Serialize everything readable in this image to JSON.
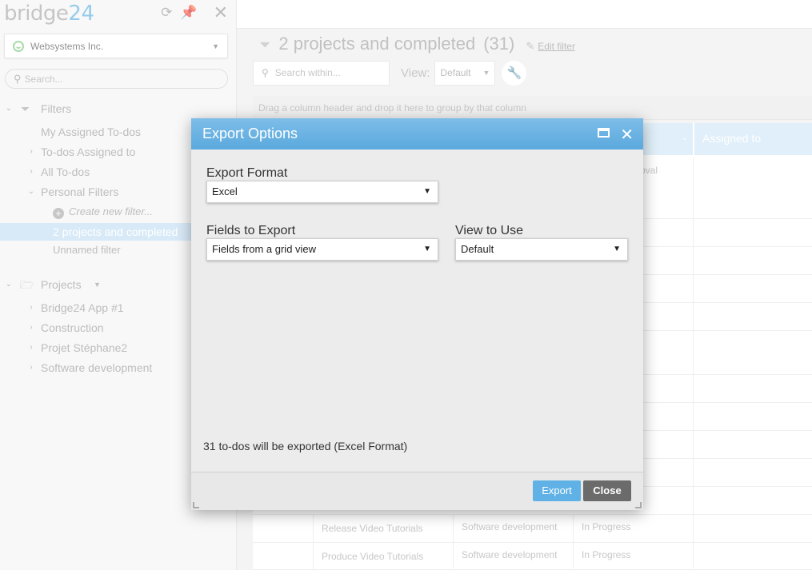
{
  "app": {
    "logo_text": "bridge",
    "logo_accent": "24",
    "refresh_icon": "refresh-icon",
    "pin_icon": "pin-icon",
    "close_icon": "close-icon"
  },
  "sidebar": {
    "account": "Websystems Inc.",
    "search_placeholder": "Search...",
    "filters_label": "Filters",
    "filter_items": [
      {
        "label": "My Assigned To-dos"
      },
      {
        "label": "To-dos Assigned to"
      },
      {
        "label": "All To-dos"
      },
      {
        "label": "Personal Filters"
      },
      {
        "label": "Create new filter..."
      },
      {
        "label": "2 projects and completed"
      },
      {
        "label": "Unnamed filter"
      }
    ],
    "projects_label": "Projects",
    "projects": [
      {
        "label": "Bridge24 App #1"
      },
      {
        "label": "Construction"
      },
      {
        "label": "Projet Stéphane2"
      },
      {
        "label": "Software development"
      }
    ]
  },
  "main": {
    "title": "2 projects and completed",
    "count": "(31)",
    "edit_filter": "Edit filter",
    "search_placeholder": "Search within...",
    "view_label": "View:",
    "view_value": "Default",
    "group_hint": "Drag a column header and drop it here to group by that column",
    "columns": {
      "assigned_to": "Assigned to"
    },
    "partial_text": "roval",
    "rows": [
      {
        "task": "Release Video Tutorials",
        "project": "Software development",
        "status": "In Progress"
      },
      {
        "task": "Produce Video Tutorials",
        "project": "Software development",
        "status": "In Progress"
      }
    ]
  },
  "dialog": {
    "title": "Export Options",
    "export_format_label": "Export Format",
    "export_format_value": "Excel",
    "fields_label": "Fields to Export",
    "fields_value": "Fields from a grid view",
    "view_label": "View to Use",
    "view_value": "Default",
    "info": "31 to-dos will be exported (Excel Format)",
    "export_button": "Export",
    "close_button": "Close"
  },
  "colors": {
    "accent": "#5fb1e6",
    "selected_bg": "#c3dff3",
    "titlebar": "#5aa9dd",
    "close_button": "#6b6b6b"
  }
}
